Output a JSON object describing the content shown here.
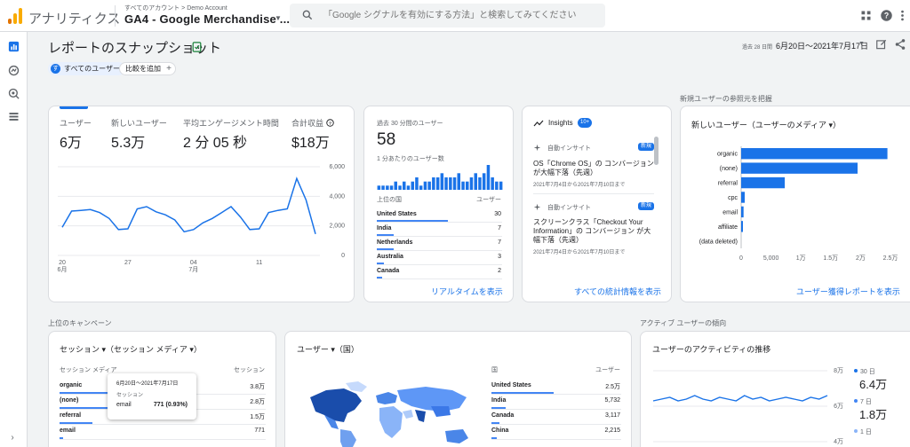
{
  "topbar": {
    "app_name": "アナリティクス",
    "account_crumb": "すべてのアカウント > Demo Account",
    "property_name": "GA4 - Google Merchandise ...",
    "search_placeholder": "「Google シグナルを有効にする方法」と検索してみてください"
  },
  "header": {
    "title": "レポートのスナップショット",
    "chip_all_users_badge": "す",
    "chip_all_users": "すべてのユーザー",
    "chip_compare": "比較を追加",
    "date_label": "過去 28 日間",
    "date_range": "6月20日～2021年7月17日"
  },
  "overview": {
    "metrics": [
      {
        "label": "ユーザー",
        "value": "6万"
      },
      {
        "label": "新しいユーザー",
        "value": "5.3万"
      },
      {
        "label": "平均エンゲージメント時間",
        "value": "2 分 05 秒"
      },
      {
        "label": "合計収益",
        "value": "$18万"
      }
    ],
    "chart_data": {
      "type": "line",
      "x_tick_labels": [
        "20",
        "6月",
        "27",
        "04",
        "7月",
        "11"
      ],
      "y_tick_labels": [
        "6,000",
        "4,000",
        "2,000",
        "0"
      ],
      "ylim": [
        0,
        6000
      ],
      "series": [
        {
          "values": [
            1900,
            3000,
            3050,
            3100,
            2900,
            2500,
            1750,
            1800,
            3150,
            3300,
            2950,
            2750,
            2400,
            1600,
            1750,
            2200,
            2500,
            2900,
            3300,
            2600,
            1750,
            1800,
            2900,
            3050,
            3150,
            5200,
            3750,
            1450
          ]
        }
      ]
    }
  },
  "realtime": {
    "title": "過去 30 分間のユーザー",
    "value": "58",
    "per_minute_label": "1 分あたりのユーザー数",
    "per_minute_bars": [
      1,
      1,
      1,
      1,
      2,
      1,
      2,
      1,
      2,
      3,
      1,
      2,
      2,
      3,
      3,
      4,
      3,
      3,
      3,
      4,
      2,
      2,
      3,
      4,
      3,
      4,
      6,
      3,
      2,
      2
    ],
    "table_header": [
      "上位の国",
      "ユーザー"
    ],
    "rows": [
      {
        "label": "United States",
        "value": "30",
        "share": 0.73
      },
      {
        "label": "India",
        "value": "7",
        "share": 0.17
      },
      {
        "label": "Netherlands",
        "value": "7",
        "share": 0.17
      },
      {
        "label": "Australia",
        "value": "3",
        "share": 0.07
      },
      {
        "label": "Canada",
        "value": "2",
        "share": 0.05
      }
    ],
    "link": "リアルタイムを表示"
  },
  "insights": {
    "title": "Insights",
    "badge": "10+",
    "items": [
      {
        "kind": "自動インサイト",
        "tag": "新規",
        "text": "OS「Chrome OS」の コンバージョン が大幅下落（先週）",
        "date": "2021年7月4日から2021年7月10日まで"
      },
      {
        "kind": "自動インサイト",
        "tag": "新規",
        "text": "スクリーンクラス「Checkout Your Information」の コンバージョン が大幅下落（先週）",
        "date": "2021年7月4日から2021年7月10日まで"
      }
    ],
    "link": "すべての統計情報を表示"
  },
  "acquisition": {
    "section_label": "新規ユーザーの参照元を把握",
    "title": "新しいユーザー（ユーザーのメディア ▾）",
    "chart_data": {
      "type": "bar",
      "orientation": "horizontal",
      "categories": [
        "organic",
        "(none)",
        "referral",
        "cpc",
        "email",
        "affiliate",
        "(data deleted)"
      ],
      "values": [
        24500,
        19500,
        7300,
        600,
        400,
        200,
        0
      ],
      "x_tick_labels": [
        "0",
        "5,000",
        "1万",
        "1.5万",
        "2万",
        "2.5万"
      ],
      "xlim": [
        0,
        25000
      ]
    },
    "link": "ユーザー獲得レポートを表示"
  },
  "campaigns": {
    "section_label": "上位のキャンペーン",
    "title": "セッション ▾（セッション メディア ▾）",
    "table_header": [
      "セッション メディア",
      "セッション"
    ],
    "rows": [
      {
        "label": "organic",
        "value": "3.8万",
        "share": 0.95
      },
      {
        "label": "(none)",
        "value": "2.8万",
        "share": 0.7
      },
      {
        "label": "referral",
        "value": "1.5万",
        "share": 0.35
      },
      {
        "label": "email",
        "value": "771",
        "share": 0.04
      }
    ],
    "tooltip": {
      "range": "6月20日～2021年7月17日",
      "metric": "セッション",
      "label": "email",
      "value": "771 (0.93%)"
    }
  },
  "map_card": {
    "title": "ユーザー ▾（国）",
    "table_header": [
      "国",
      "ユーザー"
    ],
    "rows": [
      {
        "label": "United States",
        "value": "2.5万",
        "share": 1.0
      },
      {
        "label": "India",
        "value": "5,732",
        "share": 0.23
      },
      {
        "label": "Canada",
        "value": "3,117",
        "share": 0.13
      },
      {
        "label": "China",
        "value": "2,215",
        "share": 0.09
      }
    ]
  },
  "activity": {
    "section_label": "アクティブ ユーザーの傾向",
    "title": "ユーザーのアクティビティの推移",
    "y_tick_labels": [
      "8万",
      "6万",
      "4万"
    ],
    "legend": [
      {
        "label": "30 日",
        "value": "6.4万",
        "color": "#1a73e8"
      },
      {
        "label": "7 日",
        "value": "1.8万",
        "color": "#4285f4"
      },
      {
        "label": "1 日",
        "value": "",
        "color": "#8ab4f8"
      }
    ],
    "chart_data": {
      "type": "line",
      "series": [
        {
          "name": "30 日",
          "values": [
            6.3,
            6.4,
            6.5,
            6.3,
            6.4,
            6.6,
            6.4,
            6.3,
            6.5,
            6.4,
            6.3,
            6.6,
            6.4,
            6.5,
            6.3,
            6.4,
            6.5,
            6.4,
            6.3,
            6.5,
            6.4,
            6.6
          ]
        }
      ],
      "ylim": [
        4,
        8
      ]
    }
  },
  "colors": {
    "accent": "#1a73e8",
    "bar": "#1a73e8",
    "new_badge": "#1a73e8"
  }
}
